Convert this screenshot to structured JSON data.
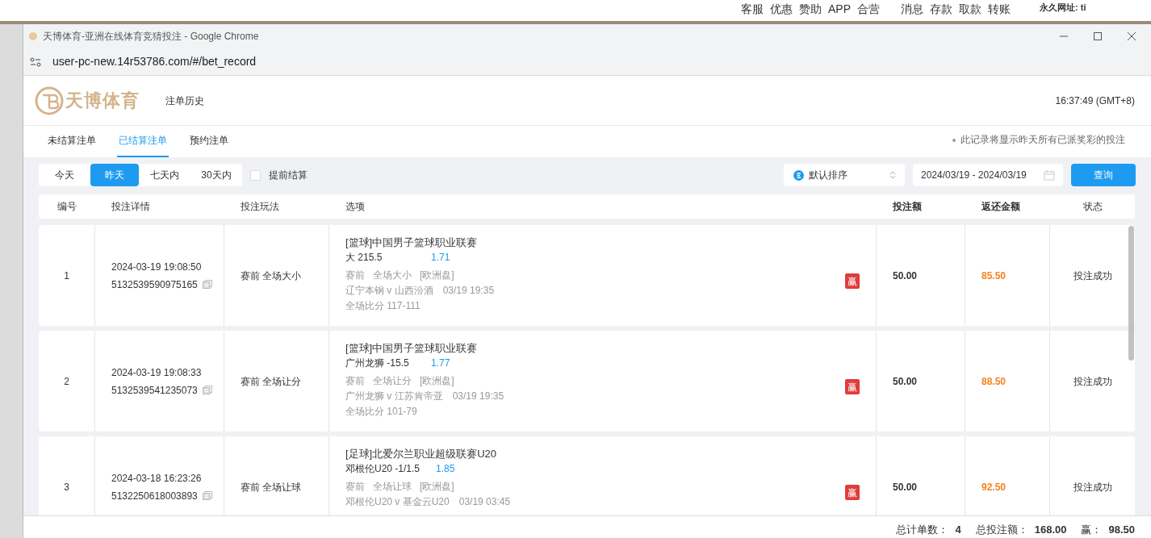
{
  "background_site": {
    "menu": [
      "客服",
      "优惠",
      "赞助",
      "APP",
      "合营",
      "消息",
      "存款",
      "取款",
      "转账"
    ],
    "url_label": "永久网址: ti"
  },
  "window": {
    "title": "天博体育-亚洲在线体育竞猜投注 - Google Chrome",
    "address": "user-pc-new.14r53786.com/#/bet_record"
  },
  "header": {
    "logo_text": "天博体育",
    "page_title": "注单历史",
    "time": "16:37:49 (GMT+8)"
  },
  "tabs": [
    {
      "label": "未结算注单",
      "selected": false
    },
    {
      "label": "已结算注单",
      "selected": true
    },
    {
      "label": "预约注单",
      "selected": false
    }
  ],
  "note": "此记录将显示昨天所有已派奖彩的投注",
  "filters": {
    "ranges": [
      {
        "label": "今天",
        "selected": false
      },
      {
        "label": "昨天",
        "selected": true
      },
      {
        "label": "七天内",
        "selected": false
      },
      {
        "label": "30天内",
        "selected": false
      }
    ],
    "early_settle": {
      "label": "提前结算",
      "checked": false
    },
    "sort": "默认排序",
    "date_range": "2024/03/19 - 2024/03/19",
    "query_button": "查询"
  },
  "table": {
    "columns": [
      "编号",
      "投注详情",
      "投注玩法",
      "选项",
      "投注额",
      "返还金额",
      "状态"
    ],
    "rows": [
      {
        "no": "1",
        "time": "2024-03-19 19:08:50",
        "order_id": "5132539590975165",
        "play": "赛前 全场大小",
        "league": "[篮球]中国男子篮球职业联赛",
        "pick": "大 215.5",
        "odds": "1.71",
        "meta": [
          "赛前",
          "全场大小",
          "[欧洲盘]"
        ],
        "match": "辽宁本钢 v 山西汾酒",
        "match_time": "03/19 19:35",
        "score": "全场比分 117-111",
        "badge": "赢",
        "stake": "50.00",
        "payout": "85.50",
        "status": "投注成功"
      },
      {
        "no": "2",
        "time": "2024-03-19 19:08:33",
        "order_id": "5132539541235073",
        "play": "赛前 全场让分",
        "league": "[篮球]中国男子篮球职业联赛",
        "pick": "广州龙狮 -15.5",
        "odds": "1.77",
        "meta": [
          "赛前",
          "全场让分",
          "[欧洲盘]"
        ],
        "match": "广州龙狮 v 江苏肯帝亚",
        "match_time": "03/19 19:35",
        "score": "全场比分 101-79",
        "badge": "赢",
        "stake": "50.00",
        "payout": "88.50",
        "status": "投注成功"
      },
      {
        "no": "3",
        "time": "2024-03-18 16:23:26",
        "order_id": "5132250618003893",
        "play": "赛前 全场让球",
        "league": "[足球]北爱尔兰职业超级联赛U20",
        "pick": "邓根伦U20 -1/1.5",
        "odds": "1.85",
        "meta": [
          "赛前",
          "全场让球",
          "[欧洲盘]"
        ],
        "match": "邓根伦U20 v 基金云U20",
        "match_time": "03/19 03:45",
        "badge": "赢",
        "stake": "50.00",
        "payout": "92.50",
        "status": "投注成功"
      }
    ]
  },
  "footer": [
    {
      "label": "总计单数：",
      "value": "4"
    },
    {
      "label": "总投注额：",
      "value": "168.00"
    },
    {
      "label": "赢：",
      "value": "98.50"
    }
  ]
}
